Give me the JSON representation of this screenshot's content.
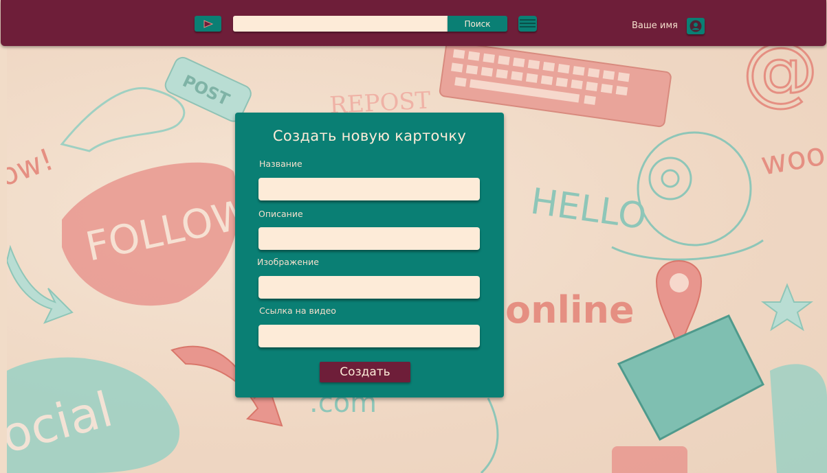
{
  "header": {
    "play_icon": "play-icon",
    "search": {
      "placeholder": "",
      "value": ""
    },
    "search_button_label": "Поиск",
    "menu_icon": "hamburger-menu-icon",
    "user_name": "Ваше имя",
    "avatar_icon": "user-avatar-icon"
  },
  "colors": {
    "header_bg": "#6e1e39",
    "accent_teal": "#0a7f74",
    "input_bg": "#fdebd8",
    "text_light": "#f4dfcc"
  },
  "form": {
    "title": "Создать новую карточку",
    "fields": [
      {
        "label": "Название",
        "value": ""
      },
      {
        "label": "Описание",
        "value": ""
      },
      {
        "label": "Изображение",
        "value": ""
      },
      {
        "label": "Ссылка на видео",
        "value": ""
      }
    ],
    "submit_label": "Создать"
  },
  "background": {
    "doodle_words": [
      "POST",
      "REPOST",
      "FOLLOW",
      "HELLO",
      "online",
      "wow!",
      "woo",
      "social",
      ".com"
    ]
  }
}
